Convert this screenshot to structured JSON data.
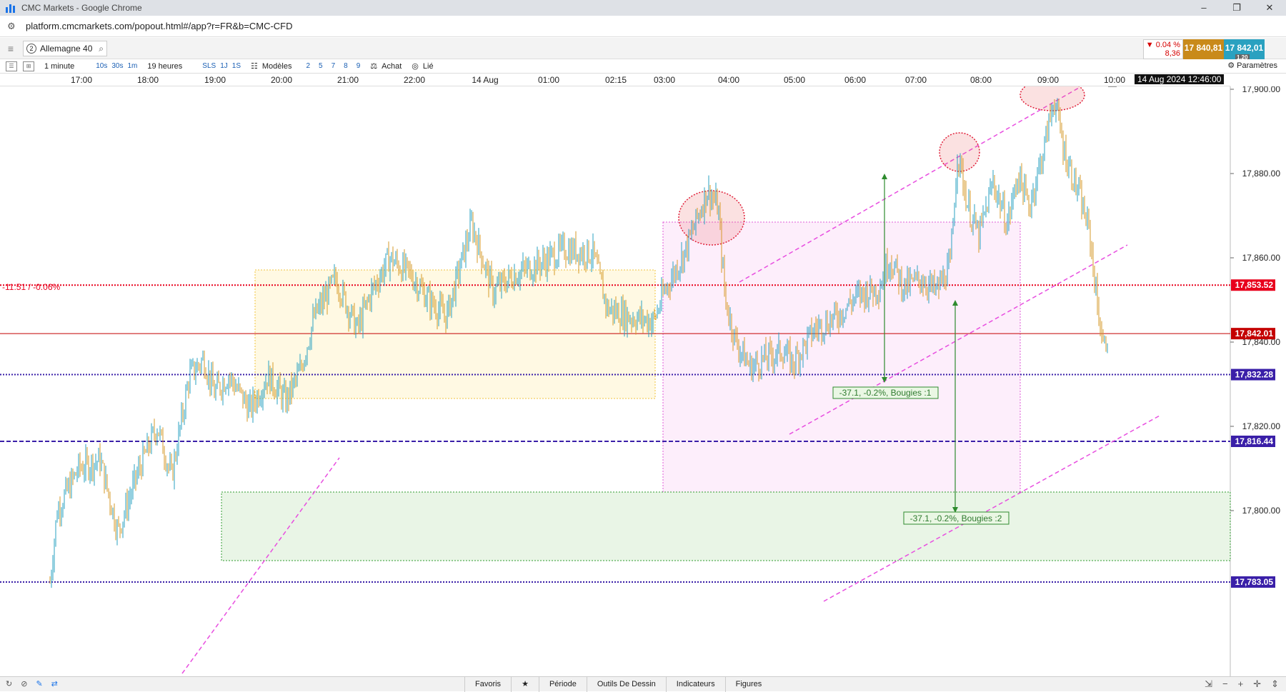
{
  "window": {
    "title": "CMC Markets - Google Chrome",
    "controls": [
      "–",
      "❐",
      "✕"
    ]
  },
  "address": {
    "url": "platform.cmcmarkets.com/popout.html#/app?r=FR&b=CMC-CFD"
  },
  "instrument": {
    "badge": "2",
    "name": "Allemagne 40"
  },
  "quote": {
    "change_pct": "▼ 0.04 %",
    "change_abs": "8,36",
    "sell": "17 840,81",
    "buy": "17 842,01",
    "spread": "1.20"
  },
  "toolbar": {
    "interval": "1 minute",
    "quick_tf": [
      "10s",
      "30s",
      "1m"
    ],
    "period": "19 heures",
    "quick_period": [
      "SLS",
      "1J",
      "1S"
    ],
    "models_label": "Modèles",
    "model_nums": [
      "2",
      "5",
      "7",
      "8",
      "9"
    ],
    "buy_label": "Achat",
    "linked_label": "Lié",
    "params_label": "Paramètres"
  },
  "time_axis": {
    "labels": [
      "17:00",
      "18:00",
      "19:00",
      "20:00",
      "21:00",
      "22:00",
      "14 Aug",
      "01:00",
      "02:15",
      "03:00",
      "04:00",
      "05:00",
      "06:00",
      "07:00",
      "08:00",
      "09:00",
      "10:00"
    ],
    "current": "14 Aug 2024 12:46:00"
  },
  "chart_data": {
    "type": "candlestick",
    "y_ticks": [
      "17,900.00",
      "17,880.00",
      "17,860.00",
      "17,840.00",
      "17,820.00",
      "17,800.00"
    ],
    "y_tick_values": [
      17900,
      17880,
      17860,
      17840,
      17820,
      17800
    ],
    "ylim": [
      17783,
      17904
    ],
    "price_levels": [
      {
        "label": "17,853.52",
        "value": 17853.52,
        "color": "#e8001c",
        "style": "dotted"
      },
      {
        "label": "17,842.01",
        "value": 17842.01,
        "color": "#c40000",
        "style": "solid"
      },
      {
        "label": "17,832.28",
        "value": 17832.28,
        "color": "#3a1fa8",
        "style": "dotted"
      },
      {
        "label": "17,816.44",
        "value": 17816.44,
        "color": "#3a1fa8",
        "style": "dashed"
      },
      {
        "label": "17,783.05",
        "value": 17783.05,
        "color": "#3a1fa8",
        "style": "dotted"
      }
    ],
    "left_annotation": "-11.51 / -0.06%",
    "measures": [
      {
        "label": "-37.1, -0.2%, Bougies :1"
      },
      {
        "label": "-37.1, -0.2%, Bougies :2"
      }
    ],
    "colors": {
      "up": "#2aa1c0",
      "down": "#d69a2a"
    }
  },
  "bottom": {
    "tabs": [
      "Favoris",
      "★",
      "Période",
      "Outils De Dessin",
      "Indicateurs",
      "Figures"
    ]
  }
}
